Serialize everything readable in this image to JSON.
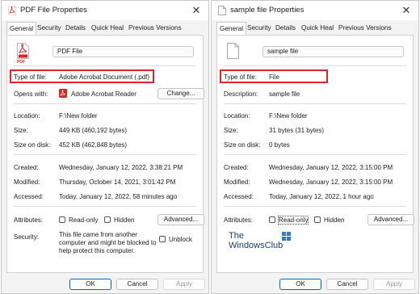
{
  "left": {
    "title": "PDF File Properties",
    "tabs": [
      "General",
      "Security",
      "Details",
      "Quick Heal",
      "Previous Versions"
    ],
    "file_name": "PDF File",
    "icon_label": "PDF",
    "type_label": "Type of file:",
    "type_value": "Adobe Acrobat Document (.pdf)",
    "opens_label": "Opens with:",
    "opens_value": "Adobe Acrobat Reader",
    "change_btn": "Change...",
    "location_label": "Location:",
    "location_value": "F:\\New folder",
    "size_label": "Size:",
    "size_value": "449 KB (460,192 bytes)",
    "disk_label": "Size on disk:",
    "disk_value": "452 KB (462,848 bytes)",
    "created_label": "Created:",
    "created_value": "Wednesday, January 12, 2022, 3:38:21 PM",
    "modified_label": "Modified:",
    "modified_value": "Thursday, October 14, 2021, 3:01:42 PM",
    "accessed_label": "Accessed:",
    "accessed_value": "Today, January 12, 2022, 58 minutes ago",
    "attributes_label": "Attributes:",
    "readonly_label": "Read-only",
    "hidden_label": "Hidden",
    "advanced_btn": "Advanced...",
    "security_label": "Security:",
    "security_text_1": "This file came from another",
    "security_text_2": "computer and might be blocked to",
    "security_text_3": "help protect this computer.",
    "unblock_label": "Unblock",
    "ok": "OK",
    "cancel": "Cancel",
    "apply": "Apply"
  },
  "right": {
    "title": "sample file Properties",
    "tabs": [
      "General",
      "Security",
      "Details",
      "Quick Heal",
      "Previous Versions"
    ],
    "file_name": "sample file",
    "type_label": "Type of file:",
    "type_value": "File",
    "desc_label": "Description:",
    "desc_value": "sample file",
    "location_label": "Location:",
    "location_value": "F:\\New folder",
    "size_label": "Size:",
    "size_value": "31 bytes (31 bytes)",
    "disk_label": "Size on disk:",
    "disk_value": "0 bytes",
    "created_label": "Created:",
    "created_value": "Wednesday, January 12, 2022, 3:15:00 PM",
    "modified_label": "Modified:",
    "modified_value": "Wednesday, January 12, 2022, 3:15:00 PM",
    "accessed_label": "Accessed:",
    "accessed_value": "Today, January 12, 2022, 1 hour ago",
    "attributes_label": "Attributes:",
    "readonly_label": "Read-only",
    "hidden_label": "Hidden",
    "advanced_btn": "Advanced...",
    "watermark_1": "The",
    "watermark_2": "WindowsClub",
    "ok": "OK",
    "cancel": "Cancel",
    "apply": "Apply"
  },
  "colors": {
    "highlight": "#e0242e",
    "accent": "#0067c0",
    "pdf_red": "#d9251c"
  }
}
